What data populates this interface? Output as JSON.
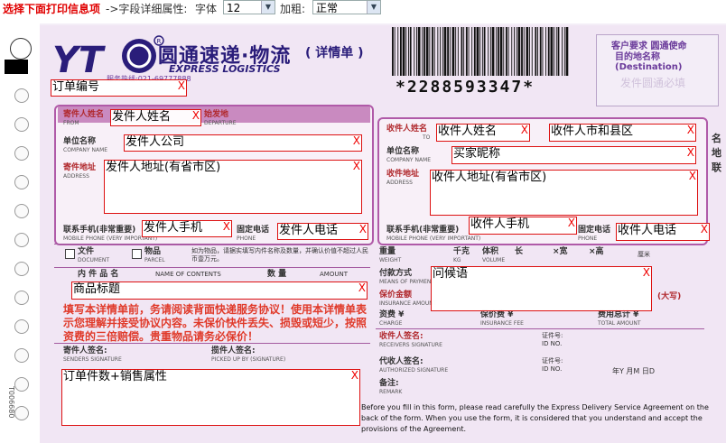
{
  "toolbar": {
    "title": "选择下面打印信息项",
    "hint": "->字段详细属性:",
    "font_label": "字体",
    "font_value": "12",
    "bold_label": "加粗:",
    "bold_value": "正常"
  },
  "form": {
    "brand": "圆通速递·物流",
    "brand_sub": "EXPRESS LOGISTICS",
    "brand_detail": "( 详情单 )",
    "phone": "服务热线:021-69777888",
    "tracking": "*2288593347*",
    "dest_header": "客户要求 圆通使命",
    "dest_label": "目的地名称 (Destination)",
    "dest_placeholder": "发件圆通必填",
    "sender_name_label": "寄件人姓名",
    "sender_name_sub": "FROM",
    "origin_label": "始发地",
    "origin_sub": "DEPARTURE",
    "company_label": "单位名称",
    "company_sub": "COMPANY NAME",
    "address_label": "寄件地址",
    "address_sub": "ADDRESS",
    "mobile_label": "联系手机(非常重要)",
    "mobile_sub": "MOBILE PHONE (VERY IMPORTANT)",
    "tel_label": "固定电话",
    "tel_sub": "PHONE",
    "doc_label": "文件",
    "doc_sub": "DOCUMENT",
    "parcel_label": "物品",
    "parcel_sub": "PARCEL",
    "content_label": "内 件 品 名",
    "content_sub": "NAME OF CONTENTS",
    "qty_label": "数 量",
    "amount_label": "AMOUNT",
    "r_name_label": "收件人姓名",
    "r_name_sub": "TO",
    "r_company_label": "单位名称",
    "r_company_sub": "COMPANY NAME",
    "r_address_label": "收件地址",
    "r_address_sub": "ADDRESS",
    "r_mobile_label": "联系手机(非常重要)",
    "r_mobile_sub": "MOBILE PHONE (VERY IMPORTANT)",
    "r_tel_label": "固定电话",
    "r_tel_sub": "PHONE",
    "weight_label": "重量",
    "weight_sub": "WEIGHT",
    "kg_label": "千克",
    "kg_sub": "KG",
    "volume_label": "体积",
    "volume_sub": "VOLUME",
    "len_label": "长",
    "wid_label": "×宽",
    "hei_label": "×高",
    "cm_label": "厘米",
    "pay_label": "付款方式",
    "pay_sub": "MEANS OF PAYMENT",
    "insure_label": "保价金额",
    "insure_sub": "INSURANCE AMOUNT",
    "insure_note": "(大写)",
    "fee_label": "资费 ¥",
    "fee_sub": "CHARGE",
    "insure_fee_label": "保价费 ¥",
    "insure_fee_sub": "INSURANCE FEE",
    "total_label": "费用总计 ¥",
    "total_sub": "TOTAL AMOUNT",
    "receiver_sign_label": "收件人签名:",
    "receiver_sign_sub": "RECEIVERS SIGNATURE",
    "proxy_sign_label": "代收人签名:",
    "proxy_sign_sub": "AUTHORIZED SIGNATURE",
    "id_label": "证件号:",
    "id_sub": "ID NO.",
    "remark_label": "备注:",
    "remark_sub": "REMARK",
    "date_label": "年Y 月M 日D",
    "sender_sign_label": "寄件人签名:",
    "sender_sign_sub": "SENDERS SIGNATURE",
    "pickup_label": "揽件人签名:",
    "pickup_sub": "PICKED UP BY (SIGNATURE)",
    "agreement": "填写本详情单前，务请阅读背面快递服务协议！使用本详情单表示您理解并接受协议内容。未保价快件丢失、损毁或短少，按照资费的三倍赔偿。贵重物品请务必保价！",
    "contents_notice": "如为物品，请据实填写内件名称及数量，并确认价值不超过人民币壹万元。",
    "fine_print": "Before you fill in this form, please read carefully the Express Delivery Service Agreement on the back of the form. When you use the form, it is considered that you understand and accept the provisions of the Agreement.",
    "side_number": "T006680",
    "right_edge_1": "名",
    "right_edge_2": "地",
    "right_edge_3": "联"
  },
  "fields": {
    "order_no": "订单编号",
    "sender_name": "发件人姓名",
    "sender_company": "发件人公司",
    "sender_address": "发件人地址(有省市区)",
    "sender_mobile": "发件人手机",
    "sender_phone": "发件人电话",
    "receiver_name": "收件人姓名",
    "receiver_city": "收件人市和县区",
    "buyer_nick": "买家昵称",
    "receiver_address": "收件人地址(有省市区)",
    "receiver_mobile": "收件人手机",
    "receiver_phone": "收件人电话",
    "product_title": "商品标题",
    "greeting": "问候语",
    "order_count": "订单件数+销售属性",
    "close_glyph": "X"
  },
  "colors": {
    "brand": "#2a1d7a",
    "accent_red": "#e00000",
    "panel_border": "#b05aa8",
    "field_border": "#dd1111"
  }
}
